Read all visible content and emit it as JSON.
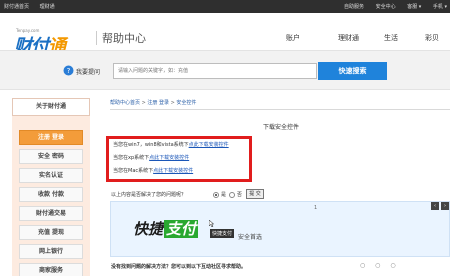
{
  "topbar": {
    "left_links": [
      "财付通首页",
      "理财通"
    ],
    "right_links": [
      "自助服务",
      "安全中心",
      "客服 ▾",
      "手机 ▾"
    ]
  },
  "header": {
    "logo_small": "Tenpay.com",
    "logo_text_a": "财付",
    "logo_text_b": "通",
    "help_title": "帮助中心",
    "nav": [
      "账户",
      "理财通",
      "生活",
      "彩贝"
    ]
  },
  "search": {
    "label": "我要提问",
    "placeholder": "请输入问题的关键字，如：充值",
    "button": "快速搜索"
  },
  "sidebar": {
    "title": "关于财付通",
    "items": [
      {
        "label": "注册 登录",
        "active": true
      },
      {
        "label": "安全 密码",
        "active": false
      },
      {
        "label": "实名认证",
        "active": false
      },
      {
        "label": "收款 付款",
        "active": false
      },
      {
        "label": "财付通交易",
        "active": false
      },
      {
        "label": "充值 提现",
        "active": false
      },
      {
        "label": "网上银行",
        "active": false
      },
      {
        "label": "商家服务",
        "active": false
      }
    ]
  },
  "main": {
    "breadcrumb": [
      "帮助中心首页",
      "注册 登录",
      "安全控件"
    ],
    "crumb_sep": ">",
    "title": "下载安全控件",
    "lines": [
      {
        "text": "当您在win7，win8和vista系统下",
        "link": "点此下载安装控件"
      },
      {
        "text": "当您在xp系统下",
        "link": "点此下载安装控件"
      },
      {
        "text": "当您在Mac系统下",
        "link": "点此下载安装控件"
      }
    ],
    "feedback_question": "以上内容是否解决了您的问题呢？",
    "yes": "是",
    "no": "否",
    "submit": "提 交",
    "banner": {
      "title_a": "快捷",
      "title_b": "支付",
      "tooltip": "快捷支付",
      "subtitle": "安全首选",
      "counter": "1"
    },
    "help_line": "没有找到问题的解决方法？您可以到以下互动社区寻求帮助。"
  }
}
